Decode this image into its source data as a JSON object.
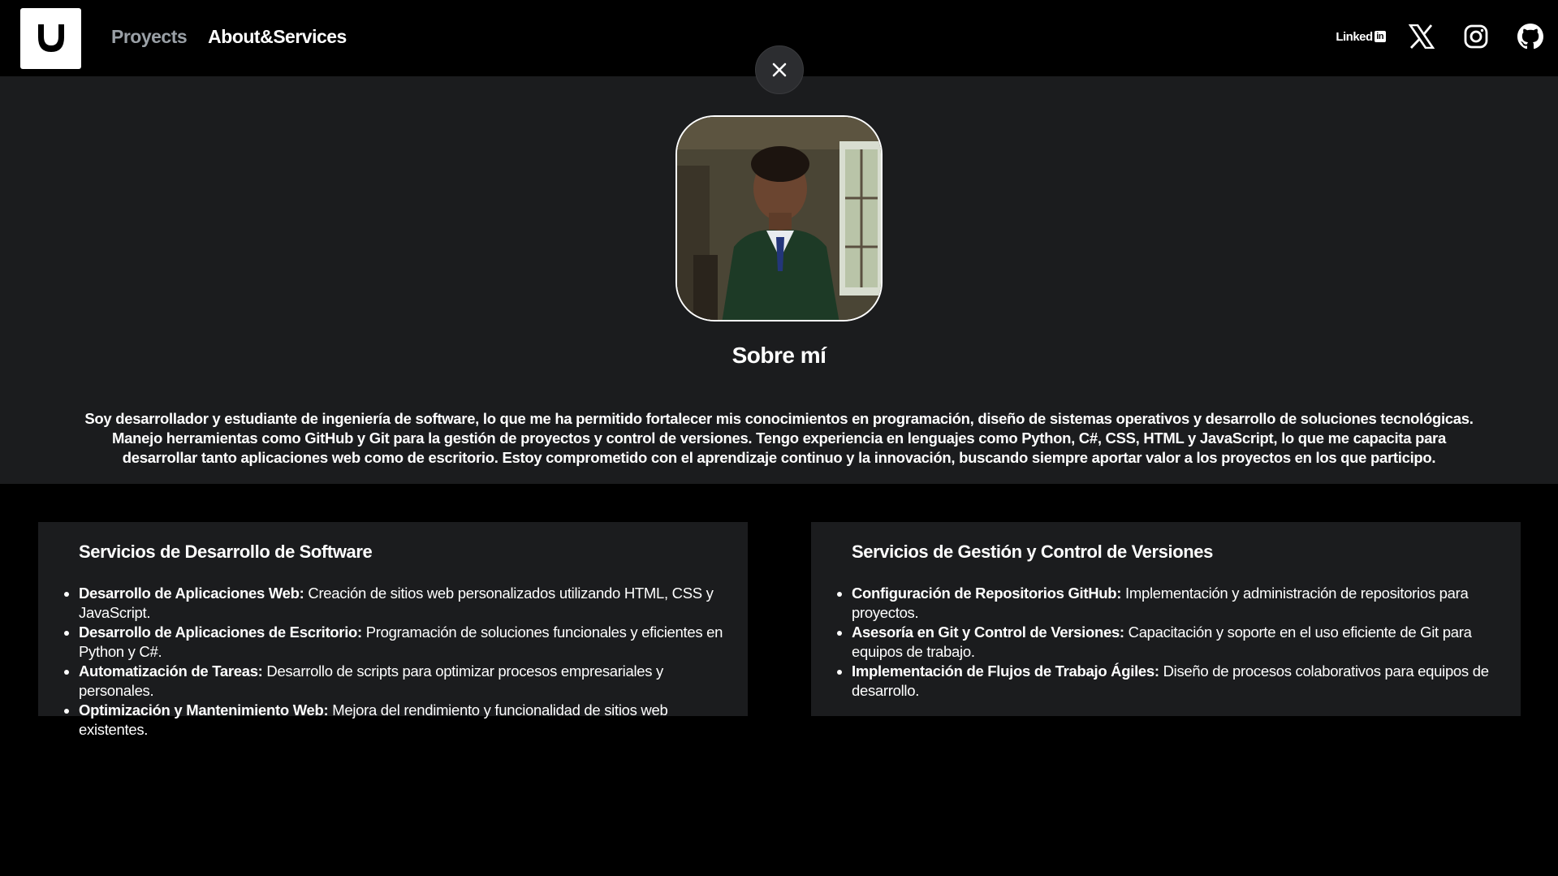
{
  "nav": {
    "logo_icon": "u-logo-icon",
    "links": [
      {
        "label": "Proyects"
      },
      {
        "label": "About&Services"
      }
    ],
    "socials": {
      "linkedin_label": "Linked",
      "linkedin_suffix": "in"
    }
  },
  "about": {
    "title": "Sobre mí",
    "text": "Soy desarrollador y estudiante de ingeniería de software, lo que me ha permitido fortalecer mis conocimientos en programación, diseño de sistemas operativos y desarrollo de soluciones tecnológicas. Manejo herramientas como GitHub y Git para la gestión de proyectos y control de versiones. Tengo experiencia en lenguajes como Python, C#, CSS, HTML y JavaScript, lo que me capacita para desarrollar tanto aplicaciones web como de escritorio. Estoy comprometido con el aprendizaje continuo y la innovación, buscando siempre aportar valor a los proyectos en los que participo."
  },
  "services": [
    {
      "title": "Servicios de Desarrollo de Software",
      "items": [
        {
          "bold": "Desarrollo de Aplicaciones Web:",
          "text": " Creación de sitios web personalizados utilizando HTML, CSS y JavaScript."
        },
        {
          "bold": "Desarrollo de Aplicaciones de Escritorio:",
          "text": " Programación de soluciones funcionales y eficientes en Python y C#."
        },
        {
          "bold": "Automatización de Tareas:",
          "text": " Desarrollo de scripts para optimizar procesos empresariales y personales."
        },
        {
          "bold": "Optimización y Mantenimiento Web:",
          "text": " Mejora del rendimiento y funcionalidad de sitios web existentes."
        }
      ]
    },
    {
      "title": "Servicios de Gestión y Control de Versiones",
      "items": [
        {
          "bold": "Configuración de Repositorios GitHub:",
          "text": " Implementación y administración de repositorios para proyectos."
        },
        {
          "bold": "Asesoría en Git y Control de Versiones:",
          "text": " Capacitación y soporte en el uso eficiente de Git para equipos de trabajo."
        },
        {
          "bold": "Implementación de Flujos de Trabajo Ágiles:",
          "text": " Diseño de procesos colaborativos para equipos de desarrollo."
        }
      ]
    }
  ],
  "colors": {
    "background": "#000000",
    "panel": "#1b1c1e",
    "inactive_link": "#9aa0a6",
    "text": "#ffffff"
  }
}
